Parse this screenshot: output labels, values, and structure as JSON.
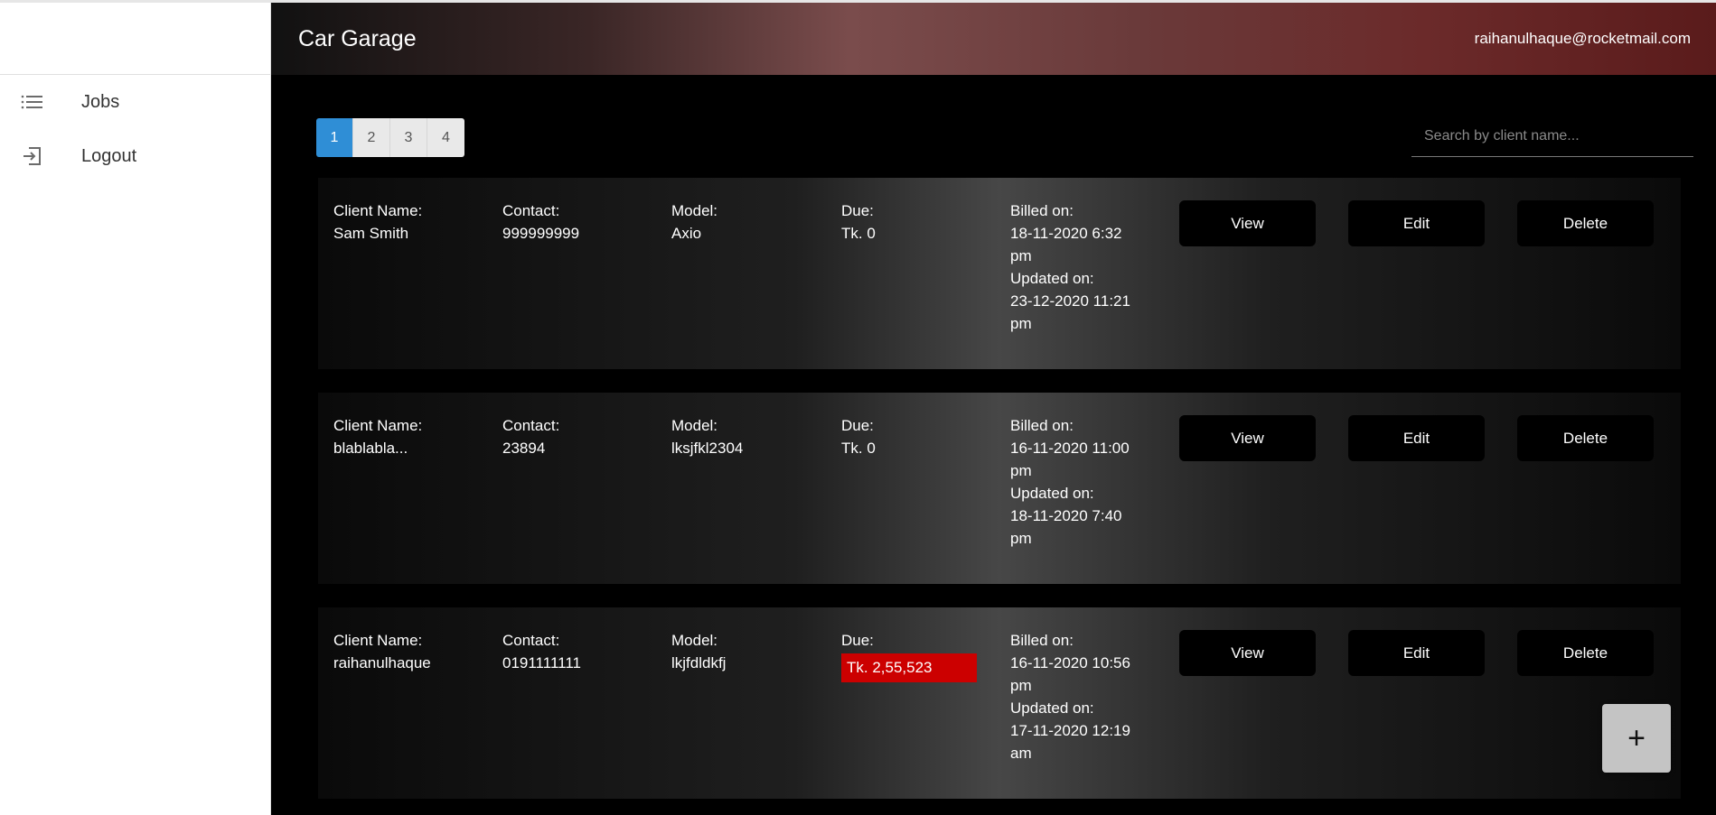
{
  "sidebar": {
    "items": [
      {
        "label": "Jobs",
        "icon": "list-icon"
      },
      {
        "label": "Logout",
        "icon": "logout-icon"
      }
    ]
  },
  "header": {
    "title": "Car Garage",
    "user_email": "raihanulhaque@rocketmail.com"
  },
  "pagination": {
    "pages": [
      "1",
      "2",
      "3",
      "4"
    ],
    "active": "1"
  },
  "search": {
    "placeholder": "Search by client name..."
  },
  "labels": {
    "client_name": "Client Name:",
    "contact": "Contact:",
    "model": "Model:",
    "due": "Due:",
    "billed_on": "Billed on:",
    "updated_on": "Updated on:",
    "view": "View",
    "edit": "Edit",
    "delete": "Delete"
  },
  "jobs": [
    {
      "client_name": "Sam Smith",
      "contact": "999999999",
      "model": "Axio",
      "due": "Tk. 0",
      "due_highlight": false,
      "billed_on": "18-11-2020 6:32 pm",
      "updated_on": "23-12-2020 11:21 pm"
    },
    {
      "client_name": "blablabla...",
      "contact": "23894",
      "model": "lksjfkl2304",
      "due": "Tk. 0",
      "due_highlight": false,
      "billed_on": "16-11-2020 11:00 pm",
      "updated_on": "18-11-2020 7:40 pm"
    },
    {
      "client_name": "raihanulhaque",
      "contact": "0191111111",
      "model": "lkjfdldkfj",
      "due": "Tk. 2,55,523",
      "due_highlight": true,
      "billed_on": "16-11-2020 10:56 pm",
      "updated_on": "17-11-2020 12:19 am"
    }
  ],
  "fab": {
    "label": "+"
  },
  "colors": {
    "accent": "#2f8ed6",
    "due_alert": "#cc0000",
    "header_gradient_end": "#5a1b1b"
  }
}
